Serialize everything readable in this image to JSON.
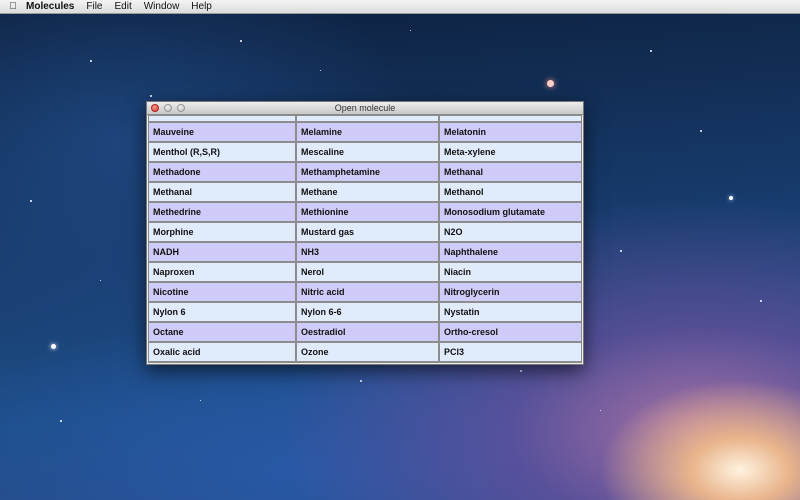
{
  "menubar": {
    "apple_icon": "apple-logo-icon",
    "app_name": "Molecules",
    "menus": [
      "File",
      "Edit",
      "Window",
      "Help"
    ]
  },
  "window": {
    "title": "Open molecule",
    "controls": [
      "close-icon",
      "minimize-icon",
      "zoom-icon"
    ]
  },
  "molecules": [
    [
      "Mauveine",
      "Melamine",
      "Melatonin"
    ],
    [
      "Menthol (R,S,R)",
      "Mescaline",
      "Meta-xylene"
    ],
    [
      "Methadone",
      "Methamphetamine",
      "Methanal"
    ],
    [
      "Methanal",
      "Methane",
      "Methanol"
    ],
    [
      "Methedrine",
      "Methionine",
      "Monosodium glutamate"
    ],
    [
      "Morphine",
      "Mustard gas",
      "N2O"
    ],
    [
      "NADH",
      "NH3",
      "Naphthalene"
    ],
    [
      "Naproxen",
      "Nerol",
      "Niacin"
    ],
    [
      "Nicotine",
      "Nitric acid",
      "Nitroglycerin"
    ],
    [
      "Nylon 6",
      "Nylon 6-6",
      "Nystatin"
    ],
    [
      "Octane",
      "Oestradiol",
      "Ortho-cresol"
    ],
    [
      "Oxalic acid",
      "Ozone",
      "PCl3"
    ]
  ],
  "colors": {
    "row_odd": "#cfcbf8",
    "row_even": "#e0ebfb"
  }
}
